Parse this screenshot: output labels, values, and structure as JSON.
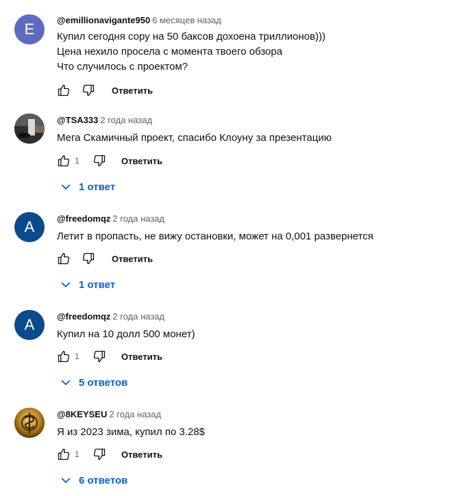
{
  "colors": {
    "accent": "#065fd4",
    "avatar_e": "#5c6bc0",
    "avatar_a": "#0b4a8b"
  },
  "comments": [
    {
      "author": "@emillionavigante950",
      "time": "6 месяцев назад",
      "text": "Купил сегодня сору на 50 баксов дохоена триллионов)))\nЦена нехило просела с момента твоего обзора\nЧто случилось с проектом?",
      "avatar_letter": "E",
      "likes": "",
      "reply_label": "Ответить",
      "replies_label": ""
    },
    {
      "author": "@TSA333",
      "time": "2 года назад",
      "text": "Мега Скамичный проект, спасибо Клоуну за презентацию",
      "avatar_letter": "",
      "likes": "1",
      "reply_label": "Ответить",
      "replies_label": "1 ответ"
    },
    {
      "author": "@freedomqz",
      "time": "2 года назад",
      "text": "Летит в пропасть, не вижу остановки, может на 0,001 развернется",
      "avatar_letter": "A",
      "likes": "",
      "reply_label": "Ответить",
      "replies_label": "1 ответ"
    },
    {
      "author": "@freedomqz",
      "time": "2 года назад",
      "text": "Купил на 10 долл 500 монет)",
      "avatar_letter": "A",
      "likes": "1",
      "reply_label": "Ответить",
      "replies_label": "5 ответов"
    },
    {
      "author": "@8KEYSEU",
      "time": "2 года назад",
      "text": "Я из 2023 зима, купил по 3.28$",
      "avatar_letter": "",
      "likes": "1",
      "reply_label": "Ответить",
      "replies_label": "6 ответов"
    }
  ]
}
